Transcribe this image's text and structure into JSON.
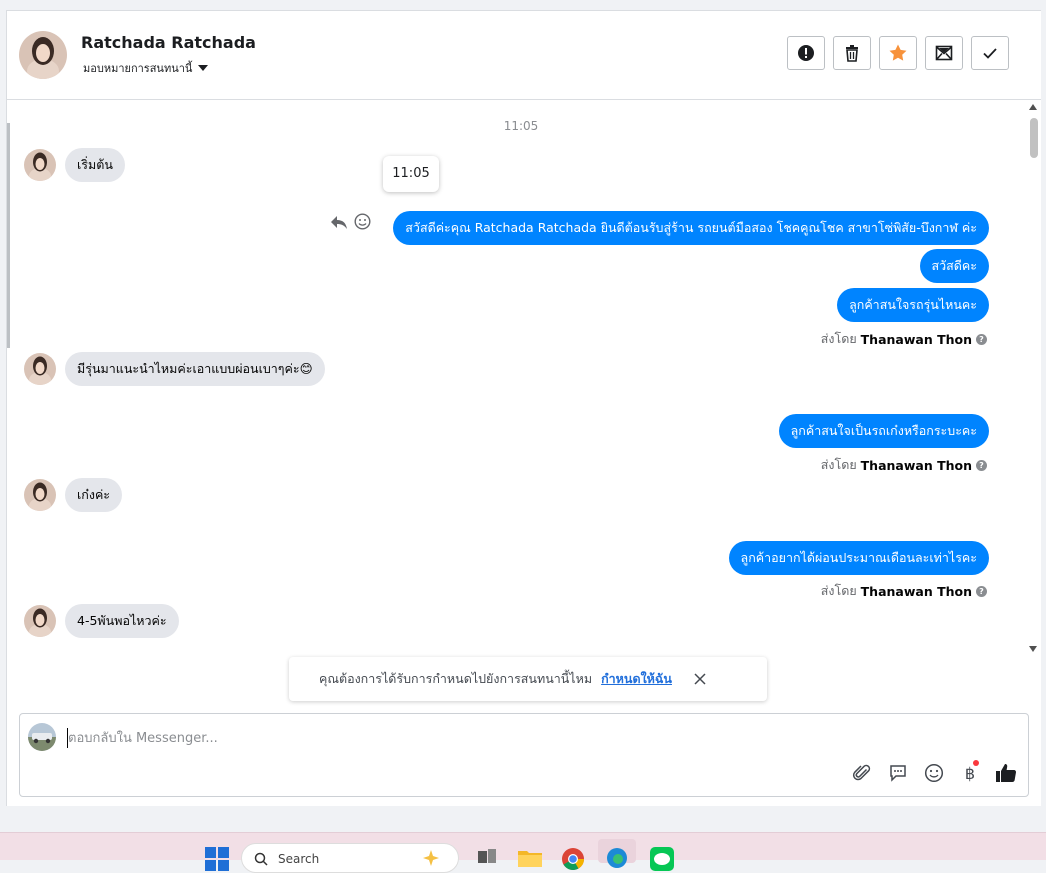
{
  "header": {
    "contact_name": "Ratchada Ratchada",
    "assign_label": "มอบหมายการสนทนานี้"
  },
  "actions": [
    {
      "name": "mark-spam-button",
      "icon": "alert-icon"
    },
    {
      "name": "delete-button",
      "icon": "trash-icon"
    },
    {
      "name": "star-button",
      "icon": "star-icon"
    },
    {
      "name": "mark-unread-button",
      "icon": "envelope-icon"
    },
    {
      "name": "mark-done-button",
      "icon": "check-icon"
    }
  ],
  "conversation": {
    "time_separator": "11:05",
    "tooltip_time": "11:05",
    "messages": [
      {
        "dir": "in",
        "text": "เริ่มต้น"
      },
      {
        "dir": "out",
        "text": "สวัสดีค่ะคุณ Ratchada Ratchada ยินดีต้อนรับสู่ร้าน รถยนต์มือสอง โชคคูณโชค สาขาโซ่พิสัย-บึงกาฬ ค่ะ"
      },
      {
        "dir": "out",
        "text": "สวัสดีคะ"
      },
      {
        "dir": "out",
        "text": "ลูกค้าสนใจรถรุ่นไหนคะ"
      },
      {
        "dir": "in",
        "text": "มีรุ่นมาแนะนำไหมค่ะเอาแบบผ่อนเบาๆค่ะ😊"
      },
      {
        "dir": "out",
        "text": "ลูกค้าสนใจเป็นรถเก๋งหรือกระบะคะ"
      },
      {
        "dir": "in",
        "text": "เก๋งค่ะ"
      },
      {
        "dir": "out",
        "text": "ลูกค้าอยากได้ผ่อนประมาณเดือนละเท่าไรคะ"
      },
      {
        "dir": "in",
        "text": "4-5พันพอไหวค่ะ"
      }
    ],
    "sent_by_prefix": "ส่งโดย",
    "sent_by_name": "Thanawan Thon",
    "help_mark": "?"
  },
  "notice": {
    "text": "คุณต้องการได้รับการกำหนดไปยังการสนทนานี้ไหม",
    "link": "กำหนดให้ฉัน"
  },
  "composer": {
    "placeholder": "ตอบกลับใน Messenger...",
    "baht_symbol": "฿"
  },
  "taskbar": {
    "search_label": "Search"
  },
  "colors": {
    "accent": "#0084ff",
    "incoming_bubble": "#e4e6eb",
    "star": "#f7923b"
  }
}
